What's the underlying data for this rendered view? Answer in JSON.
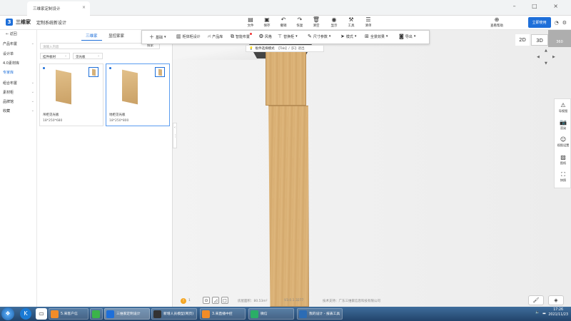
{
  "browser": {
    "tab_title": "三维家定制设计"
  },
  "app": {
    "brand": "三维家",
    "subtitle": "定制系统新设计"
  },
  "top_menu": [
    {
      "label": "文件",
      "icon": "file-icon"
    },
    {
      "label": "保存",
      "icon": "save-icon"
    },
    {
      "label": "撤销",
      "icon": "undo-icon"
    },
    {
      "label": "恢复",
      "icon": "redo-icon"
    },
    {
      "label": "清空",
      "icon": "clear-icon"
    },
    {
      "label": "显示",
      "icon": "eye-icon"
    },
    {
      "label": "工具",
      "icon": "tools-icon"
    },
    {
      "label": "清单",
      "icon": "list-icon"
    },
    {
      "label": "查看帮助",
      "icon": "help-icon"
    }
  ],
  "header_right": {
    "primary_button": "立即使用"
  },
  "sidebar": {
    "back": "返回",
    "items": [
      {
        "label": "产品布置",
        "has_chevron": true
      },
      {
        "label": "设计单",
        "has_chevron": false
      },
      {
        "label": "4.0素材库",
        "has_chevron": false
      },
      {
        "label": "专家库",
        "has_chevron": false,
        "active": true
      },
      {
        "label": "组合布置",
        "has_chevron": true
      },
      {
        "label": "素材柜",
        "has_chevron": true
      },
      {
        "label": "品牌馆",
        "has_chevron": true
      },
      {
        "label": "收藏",
        "has_chevron": true
      }
    ]
  },
  "panel": {
    "tabs": [
      {
        "label": "三维家",
        "selected": true
      },
      {
        "label": "显控家家",
        "selected": false
      }
    ],
    "search_placeholder": "请输入内容",
    "search_button": "搜索",
    "filter1": "挂件板材",
    "filter2": "见光板",
    "products": [
      {
        "name": "吊柜见光板",
        "size": "18*250*680",
        "selected": false
      },
      {
        "name": "地柜见光板",
        "size": "18*250*800",
        "selected": true
      }
    ]
  },
  "toolbar": {
    "items": [
      {
        "label": "基础",
        "icon": "plus-icon",
        "dropdown": true
      },
      {
        "label": "柜体柜设计",
        "icon": "cabinet-icon",
        "dropdown": false
      },
      {
        "label": "产品库",
        "icon": "chair-icon",
        "dropdown": false
      },
      {
        "label": "智能布置",
        "icon": "smart-icon",
        "dropdown": false,
        "badge": true
      },
      {
        "label": "风格",
        "icon": "style-icon",
        "dropdown": false
      },
      {
        "label": "替换柜",
        "icon": "replace-icon",
        "dropdown": true
      },
      {
        "label": "尺寸参数",
        "icon": "ruler-icon",
        "dropdown": true
      },
      {
        "label": "模式",
        "icon": "cursor-icon",
        "dropdown": true
      },
      {
        "label": "全景效果",
        "icon": "grid-icon",
        "dropdown": true
      },
      {
        "label": "导出",
        "icon": "export-icon",
        "dropdown": true
      }
    ],
    "hint_label": "板件选择模式",
    "hint_keys": "【Tab】/【E】退出"
  },
  "view_modes": {
    "two_d": "2D",
    "three_d": "3D",
    "badge": "360"
  },
  "right_tools": [
    {
      "label": "导视图",
      "icon": "guide-icon"
    },
    {
      "label": "渲染",
      "icon": "camera-icon"
    },
    {
      "label": "视图设置",
      "icon": "smile-icon"
    },
    {
      "label": "图纸",
      "icon": "image-icon"
    },
    {
      "label": "快照",
      "icon": "snapshot-icon"
    }
  ],
  "status": {
    "warning_count": "1",
    "area": "房屋面积：80.53m²",
    "version": "V3.0.1.3277",
    "support": "技术支持：广东三维家信息科技有限公司"
  },
  "taskbar": {
    "tasks": [
      {
        "label": "5.来客户信",
        "color": "#f28c28"
      },
      {
        "label": "",
        "color": "#3bb34a"
      },
      {
        "label": "三维家定制设计",
        "color": "#1e6fd9"
      },
      {
        "label": "新增人员模型(网页)",
        "color": "#333333"
      },
      {
        "label": "3.来直播中控",
        "color": "#f28c28"
      },
      {
        "label": "微信",
        "color": "#2aae67"
      },
      {
        "label": "我的设计 - 报表工具",
        "color": "#2b6cb5"
      }
    ],
    "time": "17:26",
    "date": "2021/11/23"
  }
}
